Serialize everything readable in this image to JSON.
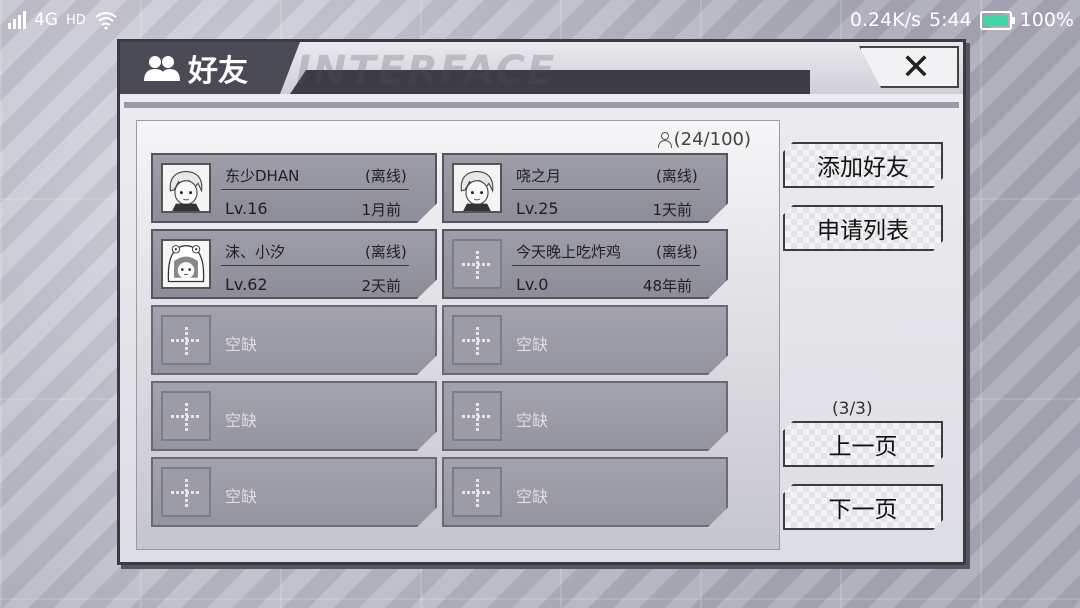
{
  "status_bar": {
    "network": "4G",
    "hd": "HD",
    "speed": "0.24K/s",
    "time": "5:44",
    "battery": "100%"
  },
  "dialog": {
    "title": "好友",
    "watermark": "INTERFACE",
    "close_label": "✕",
    "friend_count": "(24/100)"
  },
  "friends": [
    {
      "name": "东少DHAN",
      "status": "(离线)",
      "level": "Lv.16",
      "last_seen": "1月前",
      "avatar": "anime-boy-avatar"
    },
    {
      "name": "哓之月",
      "status": "(离线)",
      "level": "Lv.25",
      "last_seen": "1天前",
      "avatar": "anime-boy-avatar"
    },
    {
      "name": "沫、小汐",
      "status": "(离线)",
      "level": "Lv.62",
      "last_seen": "2天前",
      "avatar": "anime-girl-hood-avatar"
    },
    {
      "name": "今天晚上吃炸鸡",
      "status": "(离线)",
      "level": "Lv.0",
      "last_seen": "48年前",
      "avatar": "empty-plus-avatar"
    }
  ],
  "empty_slots": [
    "空缺",
    "空缺",
    "空缺",
    "空缺",
    "空缺",
    "空缺"
  ],
  "actions": {
    "add_friend": "添加好友",
    "request_list": "申请列表",
    "page_indicator": "(3/3)",
    "prev_page": "上一页",
    "next_page": "下一页"
  },
  "colors": {
    "title_tab": "#4a4a55",
    "card": "#9e9ea9",
    "battery_fill": "#3fd7a8"
  }
}
